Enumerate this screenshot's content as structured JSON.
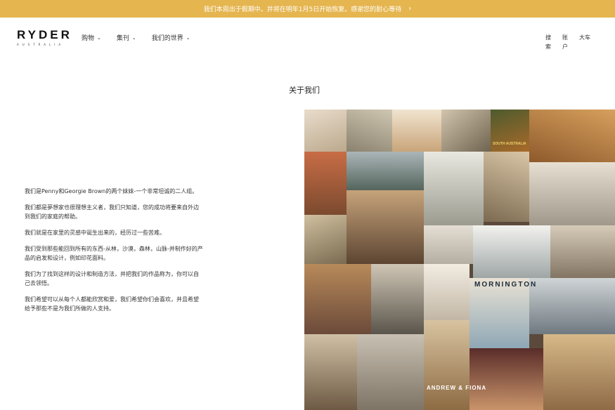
{
  "banner": {
    "text": "我们本周出于假期中。并将在明年1月5日开始恢复。感谢您的耐心等待",
    "chevron_icon": "chevron-right-icon"
  },
  "logo": {
    "name": "RYDER",
    "sub": "AUSTRALIA"
  },
  "nav": {
    "items": [
      {
        "label": "购物",
        "icon": "chevron-down-icon"
      },
      {
        "label": "集刊",
        "icon": "chevron-down-icon"
      },
      {
        "label": "我们的世界",
        "icon": "chevron-down-icon"
      }
    ]
  },
  "utility": {
    "search": "搜索",
    "account": "账户",
    "cart": "大车"
  },
  "page": {
    "title": "关于我们"
  },
  "about": {
    "paragraphs": [
      "我们是Penny和Georgie Brown的两个妹妹-一个非常坦诚的二人组。",
      "我们都是夢想家也很理想主义者，我们只知道，您的成功将要来自外边到我们的家庭的帮助。",
      "我们就是在家里的灵感中诞生出来的，经历过一些苦难。",
      "我们受到那些能回到所有的东西-从林，沙漠，森林，山脉-并制作好的产品的启发和设计，例如印花面料。",
      "我们为了找到这样的设计和制造方法，并把我们的作品称为，你可以自己去领悟。",
      "我们希望可以从每个人都能欣赏和爱，我们希望你们会喜欢，并且希望给予那些不是为我们所做的人支持。"
    ]
  },
  "collage": {
    "captions": [
      "MORNINGTON",
      "ANDREW & FIONA",
      "SOUTH AUSTRALIA"
    ],
    "colors": {
      "backdrop": "#5b4a3c",
      "banner": "#e5b54f"
    }
  }
}
